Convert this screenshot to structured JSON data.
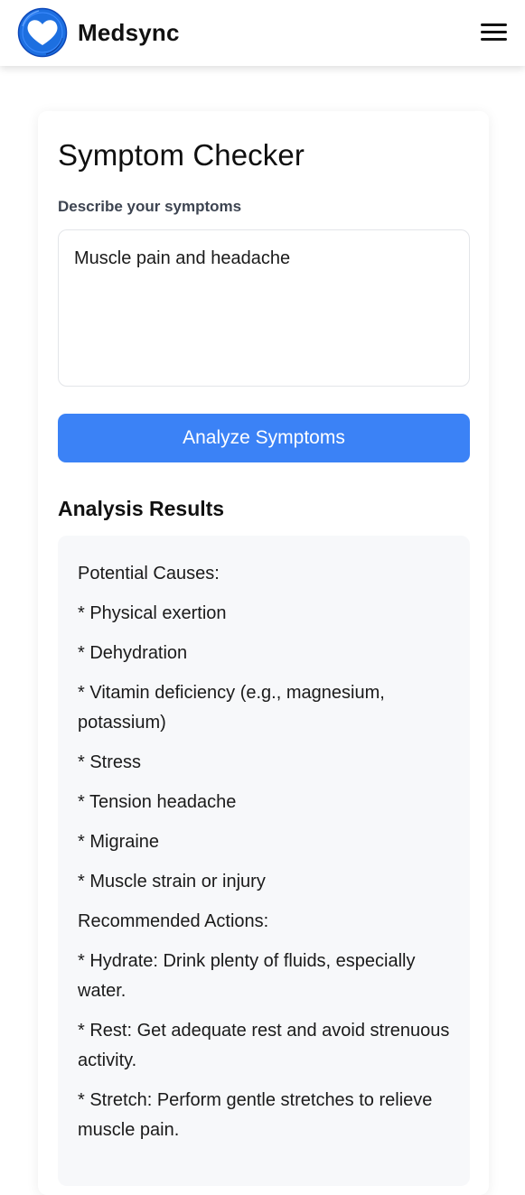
{
  "header": {
    "app_name": "Medsync",
    "logo_icon": "heart-icon",
    "menu_icon": "hamburger-menu-icon",
    "brand_color": "#1d6fe0"
  },
  "checker": {
    "title": "Symptom Checker",
    "input_label": "Describe your symptoms",
    "input_value": "Muscle pain and headache",
    "analyze_label": "Analyze Symptoms",
    "button_color": "#3b82f6"
  },
  "results": {
    "title": "Analysis Results",
    "lines": [
      "Potential Causes:",
      "* Physical exertion",
      "* Dehydration",
      "* Vitamin deficiency (e.g., magnesium, potassium)",
      "* Stress",
      "* Tension headache",
      "* Migraine",
      "* Muscle strain or injury",
      "Recommended Actions:",
      "* Hydrate: Drink plenty of fluids, especially water.",
      "* Rest: Get adequate rest and avoid strenuous activity.",
      "* Stretch: Perform gentle stretches to relieve muscle pain."
    ]
  }
}
